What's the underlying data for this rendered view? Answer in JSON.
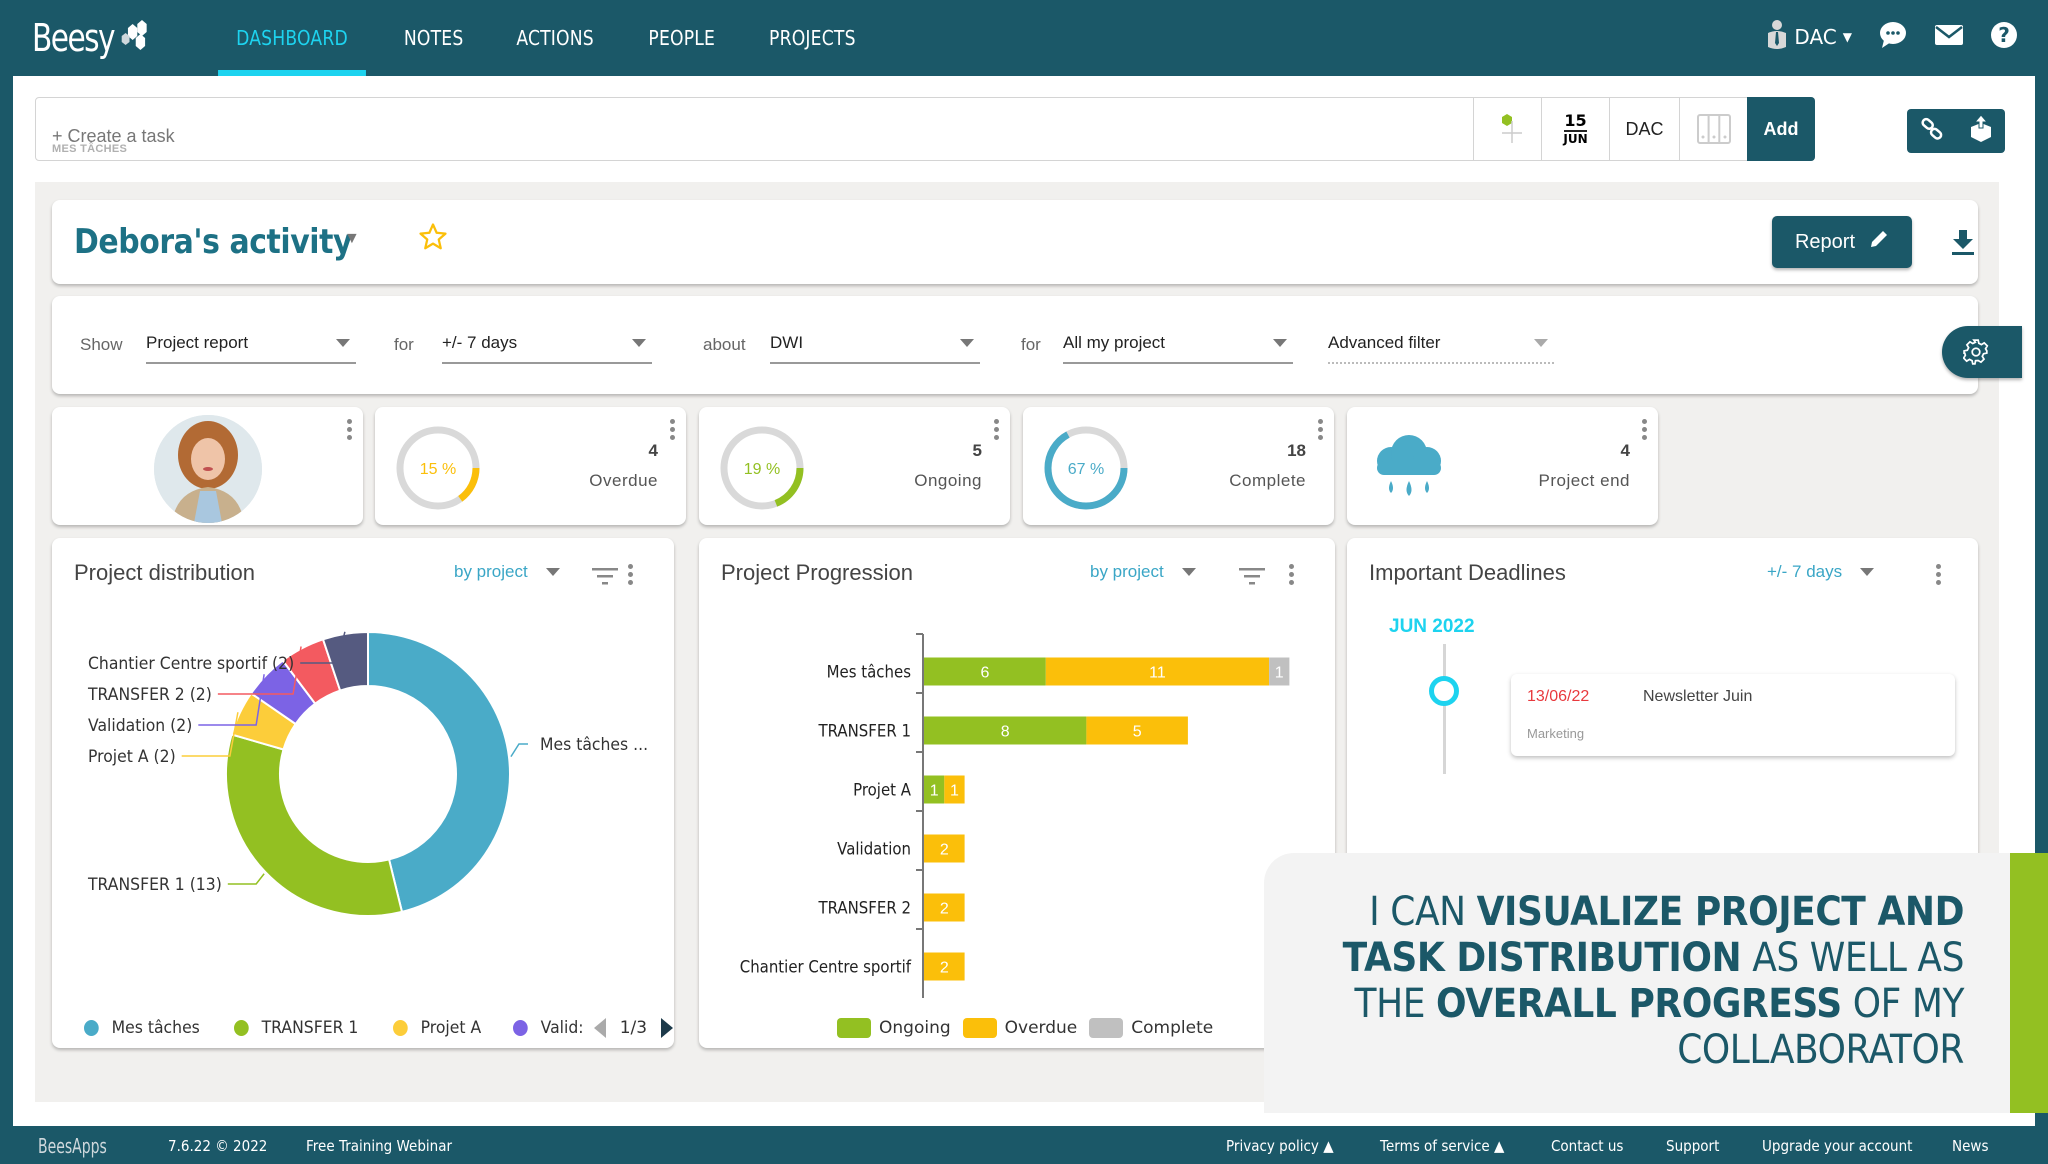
{
  "app": {
    "brand": "Beesy"
  },
  "nav": {
    "tabs": [
      {
        "label": "DASHBOARD",
        "active": true
      },
      {
        "label": "NOTES"
      },
      {
        "label": "ACTIONS"
      },
      {
        "label": "PEOPLE"
      },
      {
        "label": "PROJECTS"
      }
    ],
    "user": "DAC",
    "icons": [
      "user-icon",
      "chat-icon",
      "mail-icon",
      "help-icon"
    ]
  },
  "taskbar": {
    "placeholder": "+ Create a task",
    "sublabel": "MES TÂCHES",
    "date_day": "15",
    "date_month": "JUN",
    "assignee": "DAC",
    "add_label": "Add"
  },
  "page": {
    "title": "Debora's activity",
    "report_label": "Report"
  },
  "filters": {
    "show_label": "Show",
    "show_value": "Project report",
    "for_label": "for",
    "period_value": "+/- 7 days",
    "about_label": "about",
    "about_value": "DWI",
    "for2_label": "for",
    "scope_value": "All my project",
    "advanced_label": "Advanced filter"
  },
  "stats": [
    {
      "percent": 15,
      "percent_label": "15 %",
      "count": "4",
      "label": "Overdue",
      "color": "#fbbf0a"
    },
    {
      "percent": 19,
      "percent_label": "19 %",
      "count": "5",
      "label": "Ongoing",
      "color": "#93c022"
    },
    {
      "percent": 67,
      "percent_label": "67 %",
      "count": "18",
      "label": "Complete",
      "color": "#4aabc8"
    },
    {
      "count": "4",
      "label": "Project end",
      "icon": "rain-cloud-icon",
      "color": "#4aabc8"
    }
  ],
  "distribution": {
    "title": "Project distribution",
    "group_by": "by project",
    "legend_page": "1/3",
    "legend_visible": [
      "Mes tâches",
      "TRANSFER 1",
      "Projet A",
      "Valid:"
    ]
  },
  "progression": {
    "title": "Project Progression",
    "group_by": "by project"
  },
  "deadlines": {
    "title": "Important Deadlines",
    "range": "+/- 7 days",
    "month": "JUN 2022",
    "items": [
      {
        "date": "13/06/22",
        "name": "Newsletter Juin",
        "tag": "Marketing"
      }
    ]
  },
  "overlay": {
    "parts": [
      {
        "text": "I CAN ",
        "bold": false
      },
      {
        "text": "VISUALIZE PROJECT AND TASK DISTRIBUTION",
        "bold": true
      },
      {
        "text": " AS WELL AS THE ",
        "bold": false
      },
      {
        "text": "OVERALL PROGRESS",
        "bold": true
      },
      {
        "text": " OF MY COLLABORATOR",
        "bold": false
      }
    ]
  },
  "footer": {
    "brand": "BeesApps",
    "version": "7.6.22 © 2022",
    "webinar": "Free Training Webinar",
    "links": [
      "Privacy policy ▲",
      "Terms of service ▲",
      "Contact us",
      "Support",
      "Upgrade your account",
      "News"
    ]
  },
  "chart_data": [
    {
      "type": "pie",
      "title": "Project distribution",
      "donut": true,
      "categories": [
        "Mes tâches",
        "TRANSFER 1",
        "Projet A",
        "Validation",
        "TRANSFER 2",
        "Chantier Centre sportif"
      ],
      "values": [
        18,
        13,
        2,
        2,
        2,
        2
      ],
      "labels": [
        "Mes tâches ...",
        "TRANSFER 1 (13)",
        "Projet A (2)",
        "Validation (2)",
        "TRANSFER 2 (2)",
        "Chantier Centre sportif (2)"
      ],
      "colors": [
        "#4aabc8",
        "#93c022",
        "#fccd3a",
        "#7c63e5",
        "#f35a60",
        "#555a80"
      ],
      "legend": "bottom"
    },
    {
      "type": "bar",
      "orientation": "horizontal",
      "stacked": true,
      "title": "Project Progression",
      "categories": [
        "Mes tâches",
        "TRANSFER 1",
        "Projet A",
        "Validation",
        "TRANSFER 2",
        "Chantier Centre sportif"
      ],
      "series": [
        {
          "name": "Ongoing",
          "color": "#93c022",
          "values": [
            6,
            8,
            1,
            0,
            0,
            0
          ]
        },
        {
          "name": "Overdue",
          "color": "#fbbf0a",
          "values": [
            11,
            5,
            1,
            2,
            2,
            2
          ]
        },
        {
          "name": "Complete",
          "color": "#c0c0c0",
          "values": [
            1,
            0,
            0,
            0,
            0,
            0
          ]
        }
      ],
      "xlim": [
        0,
        18
      ],
      "legend": "bottom"
    }
  ]
}
